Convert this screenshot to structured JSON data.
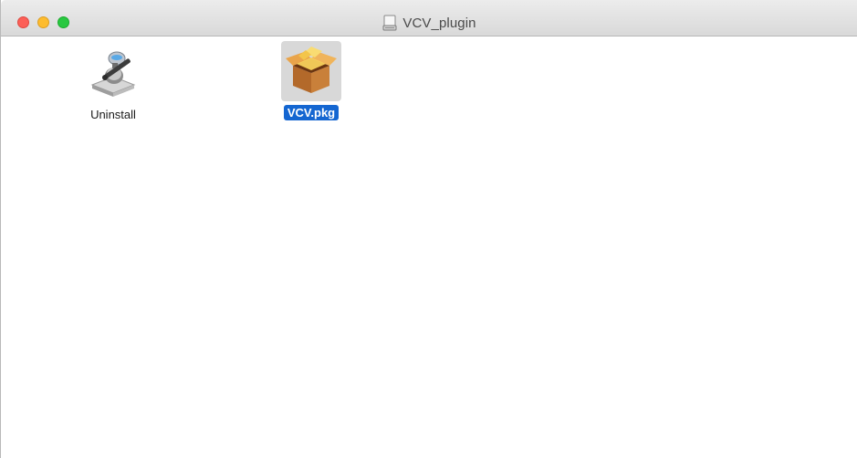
{
  "window": {
    "title": "VCV_plugin",
    "title_icon": "disk-image-icon",
    "buttons": [
      "close",
      "minimize",
      "zoom"
    ]
  },
  "files": [
    {
      "name": "Uninstall",
      "icon": "automator-app-icon",
      "selected": false
    },
    {
      "name": "VCV.pkg",
      "icon": "package-box-icon",
      "selected": true
    }
  ],
  "colors": {
    "selection": "#1466d1",
    "close": "#fc5f57",
    "minimize": "#fdbc2e",
    "zoom": "#28c840"
  }
}
